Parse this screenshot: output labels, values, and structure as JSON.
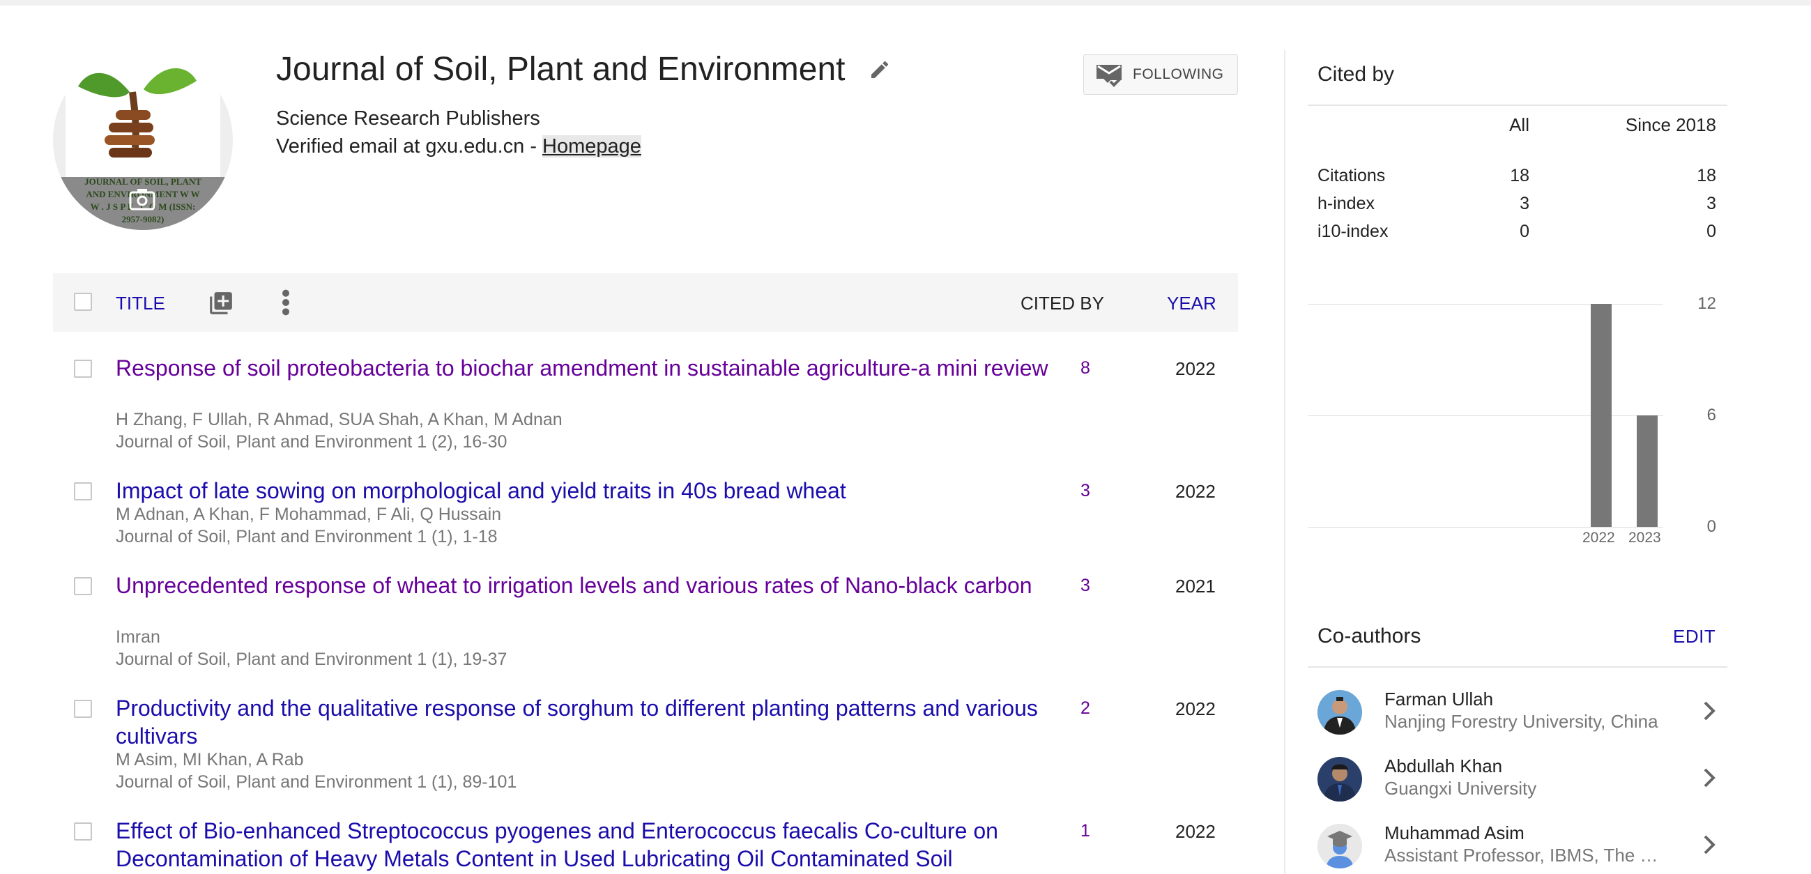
{
  "profile": {
    "name": "Journal of Soil, Plant and Environment",
    "affiliation": "Science Research Publishers",
    "verified_prefix": "Verified email at gxu.edu.cn - ",
    "homepage_label": "Homepage",
    "follow_label": "FOLLOWING",
    "logo_text": "JOURNAL OF SOIL, PLANT AND ENVIRONMENT W W W . J S P E . C O M (ISSN: 2957-9082)",
    "icons": {
      "edit": "pencil-icon",
      "follow": "email-check-icon",
      "avatar_overlay": "camera-icon"
    }
  },
  "table": {
    "title_label": "TITLE",
    "cited_by_label": "CITED BY",
    "year_label": "YEAR",
    "icons": {
      "add": "add-to-library-icon",
      "more": "more-vert-icon"
    }
  },
  "articles": [
    {
      "title": "Response of soil proteobacteria to biochar amendment in sustainable agriculture-a mini review",
      "authors": "H Zhang, F Ullah, R Ahmad, SUA Shah, A Khan, M Adnan",
      "venue": "Journal of Soil, Plant and Environment 1 (2), 16-30",
      "cited_by": "8",
      "year": "2022",
      "visited": true
    },
    {
      "title": "Impact of late sowing on morphological and yield traits in 40s bread wheat",
      "authors": "M Adnan, A Khan, F Mohammad, F Ali, Q Hussain",
      "venue": "Journal of Soil, Plant and Environment 1 (1), 1-18",
      "cited_by": "3",
      "year": "2022",
      "visited": false
    },
    {
      "title": "Unprecedented response of wheat to irrigation levels and various rates of Nano-black carbon",
      "authors": "Imran",
      "venue": "Journal of Soil, Plant and Environment 1 (1), 19-37",
      "cited_by": "3",
      "year": "2021",
      "visited": true
    },
    {
      "title": "Productivity and the qualitative response of sorghum to different planting patterns and various cultivars",
      "authors": "M Asim, MI Khan, A Rab",
      "venue": "Journal of Soil, Plant and Environment 1 (1), 89-101",
      "cited_by": "2",
      "year": "2022",
      "visited": false
    },
    {
      "title": "Effect of Bio-enhanced Streptococcus pyogenes and Enterococcus faecalis Co-culture on Decontamination of Heavy Metals Content in Used Lubricating Oil Contaminated Soil",
      "authors": "",
      "venue": "",
      "cited_by": "1",
      "year": "2022",
      "visited": false
    }
  ],
  "cited_by": {
    "title": "Cited by",
    "col_all": "All",
    "col_since": "Since 2018",
    "rows": [
      {
        "label": "Citations",
        "all": "18",
        "since": "18"
      },
      {
        "label": "h-index",
        "all": "3",
        "since": "3"
      },
      {
        "label": "i10-index",
        "all": "0",
        "since": "0"
      }
    ]
  },
  "chart_data": {
    "type": "bar",
    "categories": [
      "2022",
      "2023"
    ],
    "values": [
      12,
      6
    ],
    "title": "",
    "xlabel": "",
    "ylabel": "",
    "ylim": [
      0,
      12
    ],
    "yticks": [
      "12",
      "6",
      "0"
    ],
    "grid": true,
    "bar_color": "#777777"
  },
  "coauthors": {
    "title": "Co-authors",
    "edit_label": "EDIT",
    "items": [
      {
        "name": "Farman Ullah",
        "affiliation": "Nanjing Forestry University, China"
      },
      {
        "name": "Abdullah Khan",
        "affiliation": "Guangxi University"
      },
      {
        "name": "Muhammad Asim",
        "affiliation": "Assistant Professor, IBMS, The …"
      }
    ]
  },
  "colors": {
    "link": "#1a0dab",
    "visited": "#660099",
    "muted": "#777777",
    "header_bg": "#f5f5f5"
  }
}
